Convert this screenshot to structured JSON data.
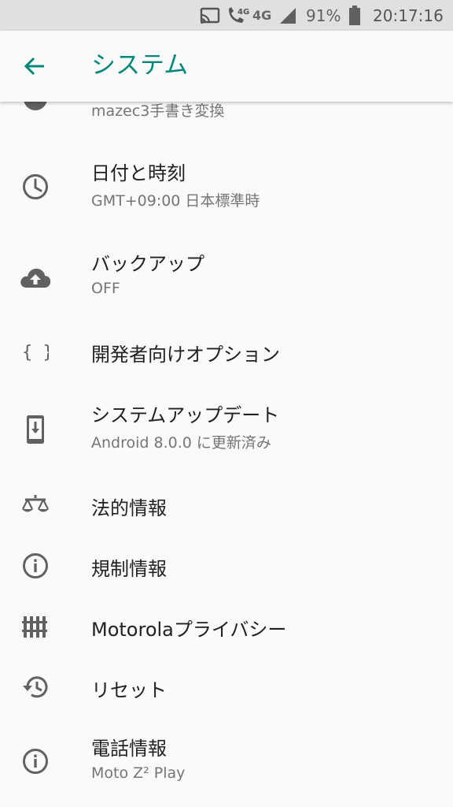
{
  "status_bar": {
    "network": "4G",
    "battery_percent": "91%",
    "time": "20:17:16",
    "icons": [
      "cast-icon",
      "volte-call-icon",
      "signal-icon",
      "battery-icon"
    ]
  },
  "app_bar": {
    "title": "システム",
    "accent_color": "#00897b"
  },
  "items": [
    {
      "icon": "keyboard-icon",
      "subtitle": "mazec3手書き変換"
    },
    {
      "icon": "clock-icon",
      "title": "日付と時刻",
      "subtitle": "GMT+09:00 日本標準時"
    },
    {
      "icon": "cloud-upload-icon",
      "title": "バックアップ",
      "subtitle": "OFF"
    },
    {
      "icon": "braces-icon",
      "title": "開発者向けオプション"
    },
    {
      "icon": "system-update-icon",
      "title": "システムアップデート",
      "subtitle": "Android 8.0.0 に更新済み"
    },
    {
      "icon": "scale-icon",
      "title": "法的情報"
    },
    {
      "icon": "info-icon",
      "title": "規制情報"
    },
    {
      "icon": "fence-icon",
      "title": "Motorolaプライバシー"
    },
    {
      "icon": "history-icon",
      "title": "リセット"
    },
    {
      "icon": "info-icon",
      "title": "電話情報",
      "subtitle": "Moto Z² Play"
    }
  ]
}
